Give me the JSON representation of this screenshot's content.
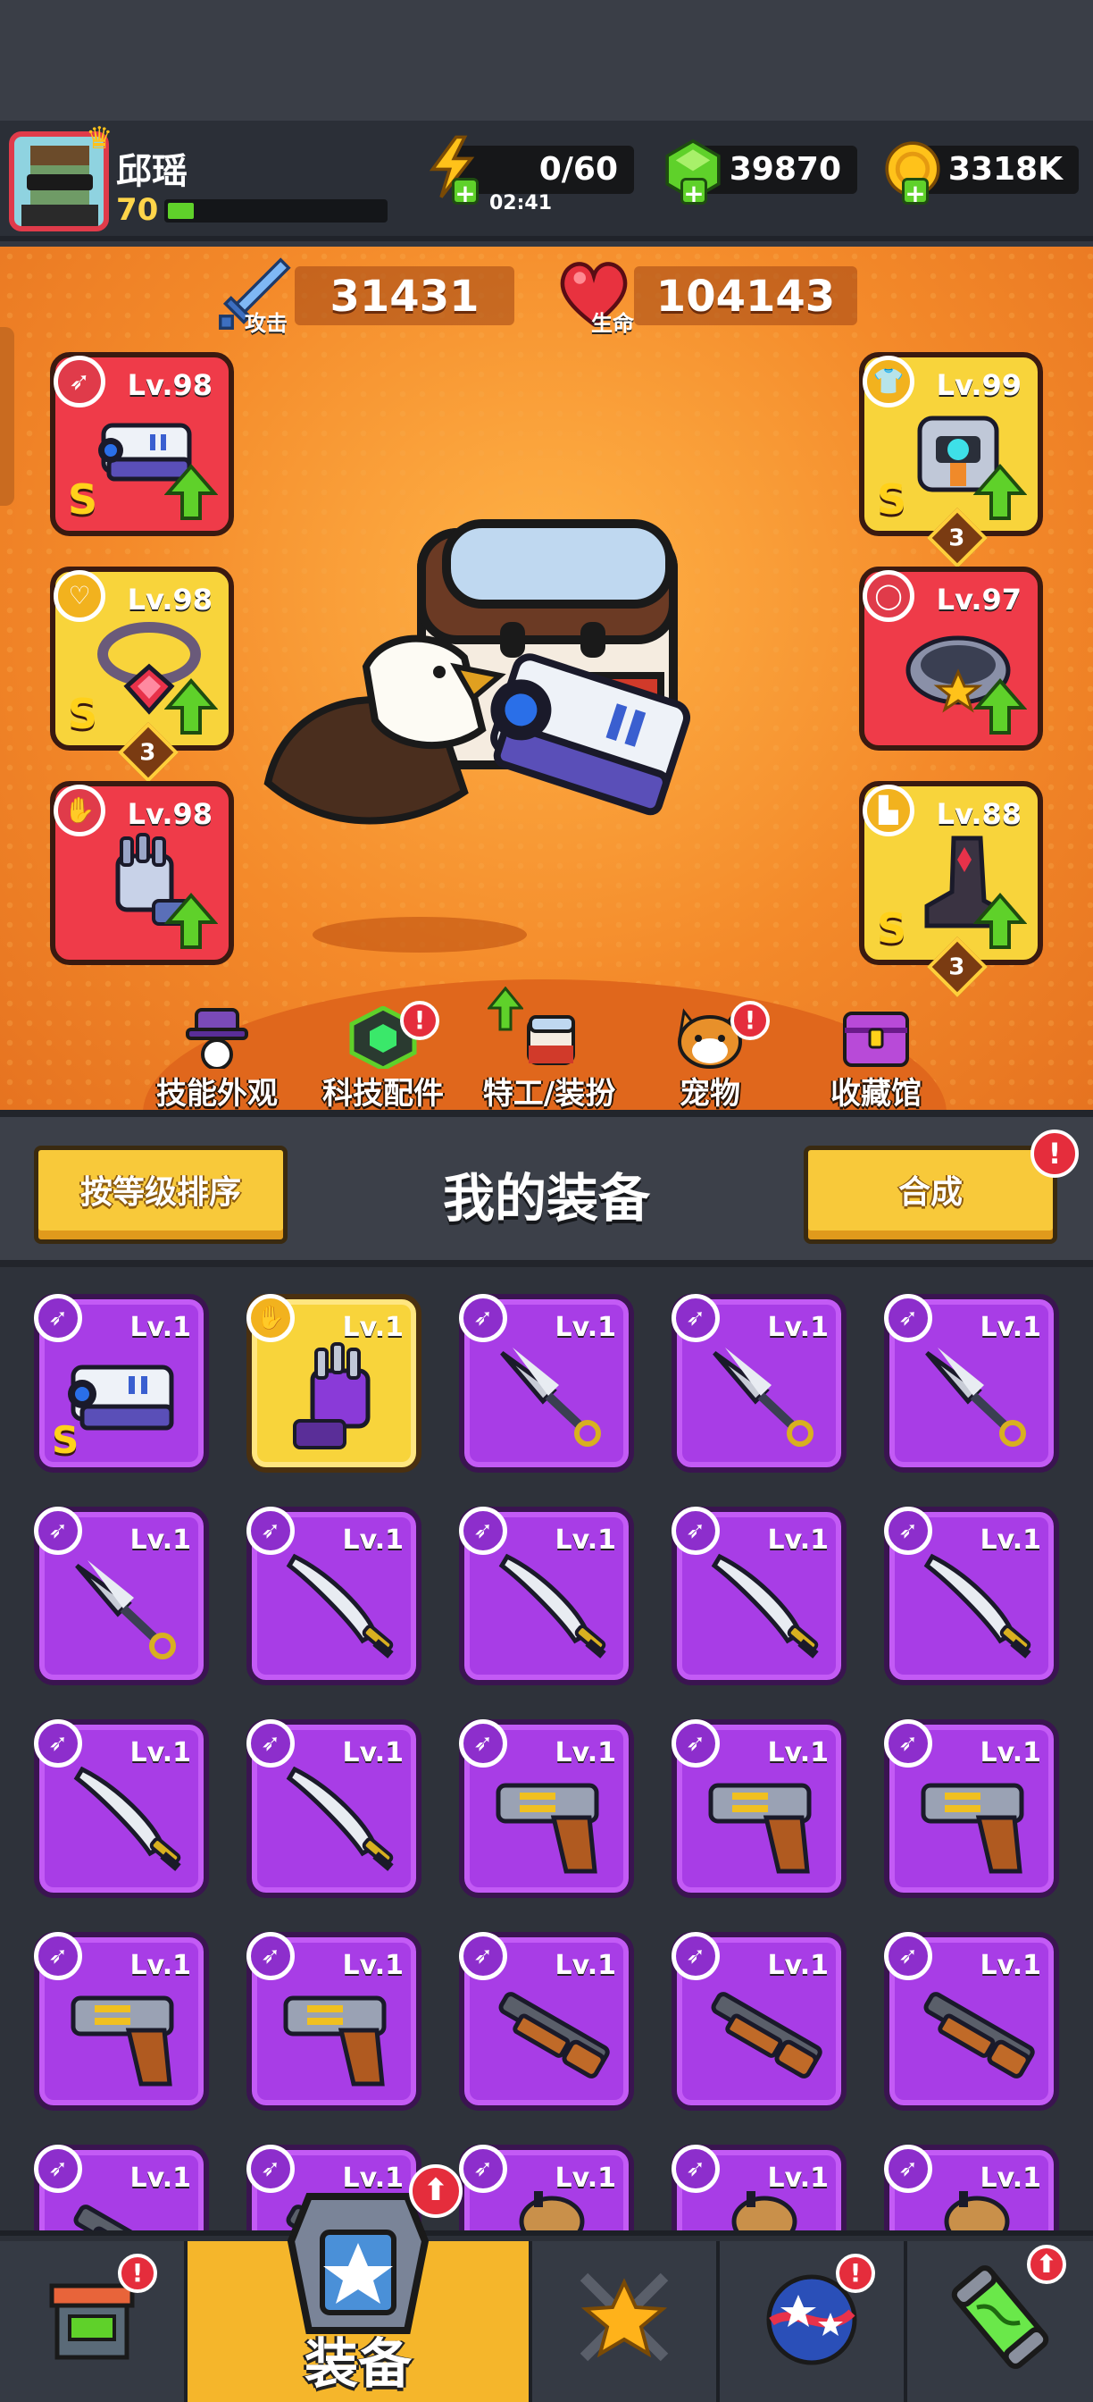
{
  "player": {
    "name": "邱瑶",
    "level": "70",
    "xp_fraction": 0.12
  },
  "resources": {
    "energy": {
      "value": "0/60",
      "timer": "02:41",
      "icon": "lightning-icon"
    },
    "gems": {
      "value": "39870",
      "icon": "green-gem-icon"
    },
    "coins": {
      "value": "3318K",
      "icon": "gold-coin-icon"
    }
  },
  "stats": {
    "attack": {
      "value": "31431",
      "label": "攻击",
      "icon": "sword-icon"
    },
    "health": {
      "value": "104143",
      "label": "生命",
      "icon": "heart-icon"
    }
  },
  "equipped": {
    "weapon": {
      "level": "Lv.98",
      "grade": "S",
      "icon": "blaster-gun-icon"
    },
    "necklace": {
      "level": "Lv.98",
      "grade": "S",
      "stars": "3",
      "icon": "chain-necklace-icon"
    },
    "gloves": {
      "level": "Lv.98",
      "icon": "robot-glove-icon"
    },
    "armor": {
      "level": "Lv.99",
      "grade": "S",
      "stars": "3",
      "icon": "mech-armor-icon"
    },
    "belt": {
      "level": "Lv.97",
      "icon": "star-belt-icon"
    },
    "boots": {
      "level": "Lv.88",
      "grade": "S",
      "stars": "3",
      "icon": "spiked-boot-icon"
    }
  },
  "shortcuts": [
    {
      "label": "技能外观",
      "icon": "skill-skin-icon"
    },
    {
      "label": "科技配件",
      "icon": "tech-hexagon-icon"
    },
    {
      "label": "特工/装扮",
      "icon": "agent-outfit-icon"
    },
    {
      "label": "宠物",
      "icon": "shiba-pet-icon"
    },
    {
      "label": "收藏馆",
      "icon": "treasure-chest-icon"
    }
  ],
  "equipment_panel": {
    "title": "我的装备",
    "sort_label": "按等级排序",
    "merge_label": "合成",
    "alert": "!"
  },
  "inventory": [
    {
      "level": "Lv.1",
      "item": "blaster",
      "grade": "S",
      "rarity": "purple"
    },
    {
      "level": "Lv.1",
      "item": "glove",
      "rarity": "gold"
    },
    {
      "level": "Lv.1",
      "item": "kunai",
      "rarity": "purple"
    },
    {
      "level": "Lv.1",
      "item": "kunai",
      "rarity": "purple"
    },
    {
      "level": "Lv.1",
      "item": "kunai",
      "rarity": "purple"
    },
    {
      "level": "Lv.1",
      "item": "kunai",
      "rarity": "purple"
    },
    {
      "level": "Lv.1",
      "item": "machete",
      "rarity": "purple"
    },
    {
      "level": "Lv.1",
      "item": "machete",
      "rarity": "purple"
    },
    {
      "level": "Lv.1",
      "item": "machete",
      "rarity": "purple"
    },
    {
      "level": "Lv.1",
      "item": "machete",
      "rarity": "purple"
    },
    {
      "level": "Lv.1",
      "item": "machete",
      "rarity": "purple"
    },
    {
      "level": "Lv.1",
      "item": "machete",
      "rarity": "purple"
    },
    {
      "level": "Lv.1",
      "item": "revolver",
      "rarity": "purple"
    },
    {
      "level": "Lv.1",
      "item": "revolver",
      "rarity": "purple"
    },
    {
      "level": "Lv.1",
      "item": "revolver",
      "rarity": "purple"
    },
    {
      "level": "Lv.1",
      "item": "revolver",
      "rarity": "purple"
    },
    {
      "level": "Lv.1",
      "item": "revolver",
      "rarity": "purple"
    },
    {
      "level": "Lv.1",
      "item": "shotgun",
      "rarity": "purple"
    },
    {
      "level": "Lv.1",
      "item": "shotgun",
      "rarity": "purple"
    },
    {
      "level": "Lv.1",
      "item": "shotgun",
      "rarity": "purple"
    },
    {
      "level": "Lv.1",
      "item": "shotgun",
      "rarity": "purple"
    },
    {
      "level": "Lv.1",
      "item": "shotgun",
      "rarity": "purple"
    },
    {
      "level": "Lv.1",
      "item": "bomb",
      "rarity": "purple"
    },
    {
      "level": "Lv.1",
      "item": "bomb",
      "rarity": "purple"
    },
    {
      "level": "Lv.1",
      "item": "bomb",
      "rarity": "purple"
    }
  ],
  "bottom_nav": [
    {
      "label": "",
      "icon": "shop-icon",
      "alert": true
    },
    {
      "label": "装备",
      "icon": "armor-star-icon",
      "active": true,
      "upgrade": true
    },
    {
      "label": "",
      "icon": "crossed-swords-star-icon"
    },
    {
      "label": "",
      "icon": "planet-stars-icon",
      "alert": true
    },
    {
      "label": "",
      "icon": "dna-capsule-icon",
      "upgrade": true
    }
  ],
  "colors": {
    "hero_bg": "#f48a2a",
    "rarity_purple": "#a83de6",
    "rarity_gold": "#f8d43b",
    "slot_red": "#ef3b49",
    "accent_green": "#5fd12a"
  }
}
